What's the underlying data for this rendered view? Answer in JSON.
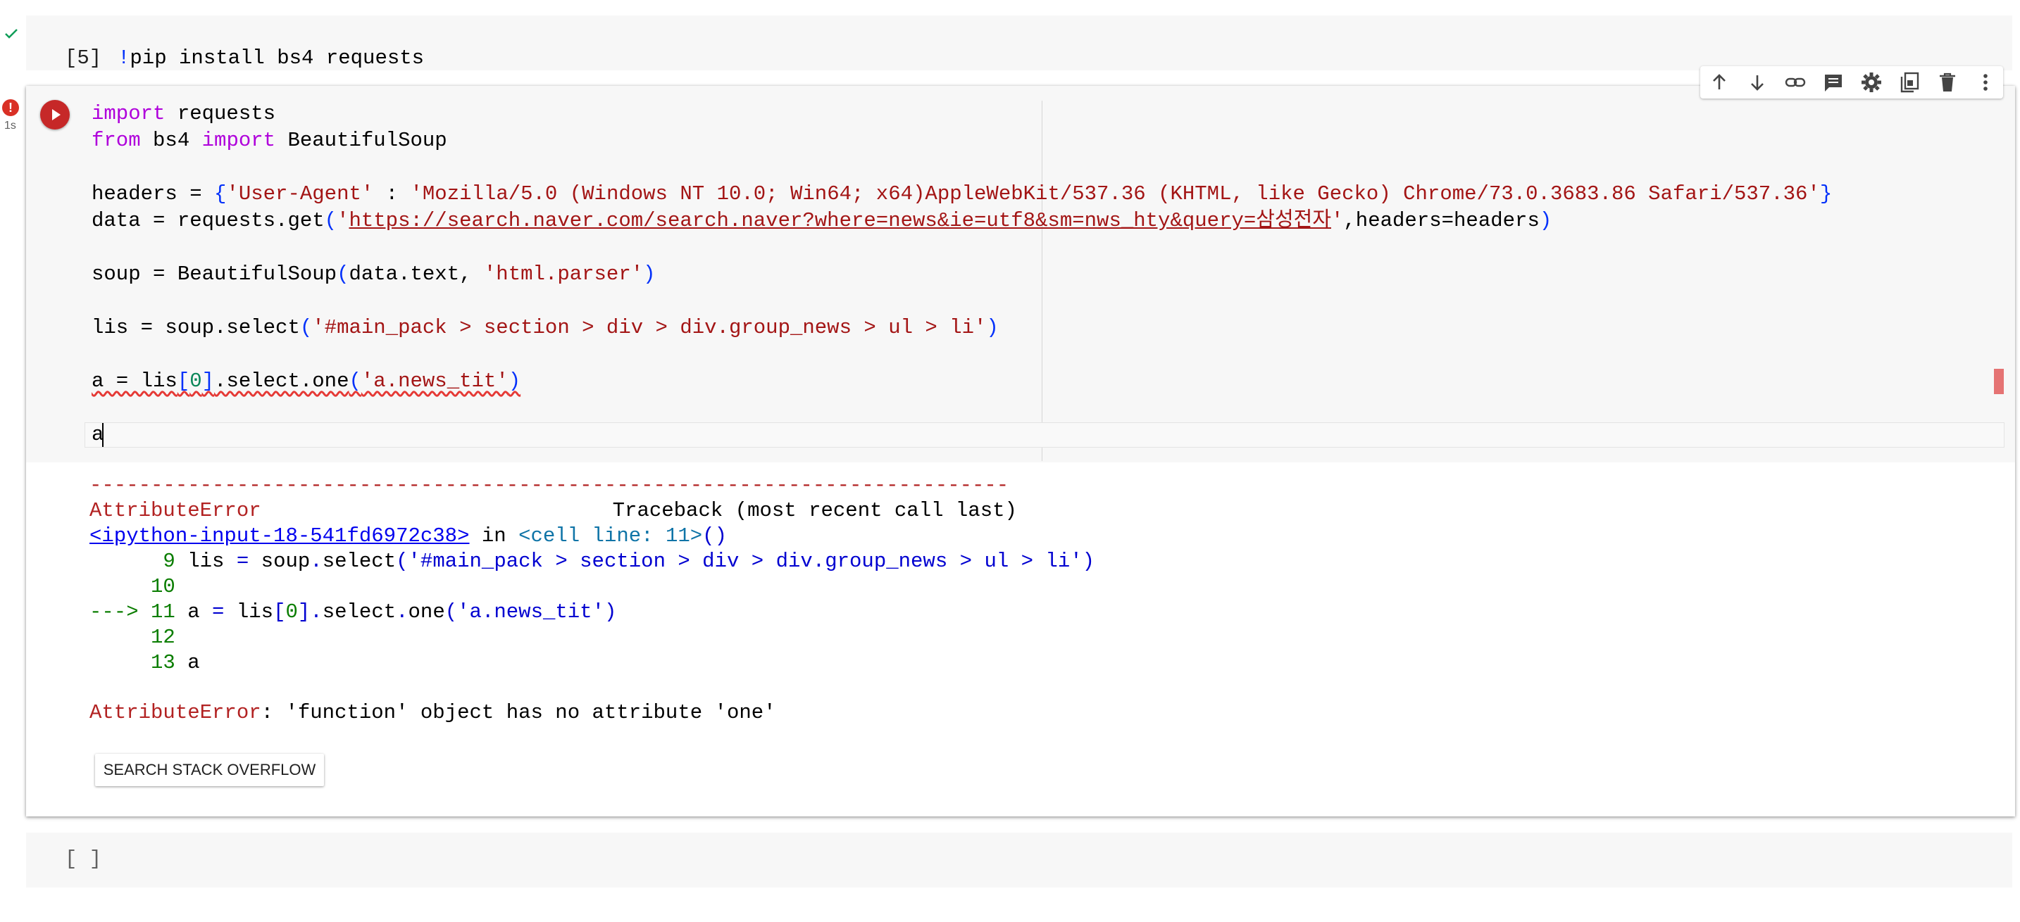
{
  "cell1": {
    "exec_count": "[5]",
    "bang": "!",
    "command": "pip install bs4 requests"
  },
  "cell2": {
    "error_badge": "!",
    "exec_time": "1s",
    "code": {
      "l1_kw": "import",
      "l1_rest": " requests",
      "l2_kw1": "from",
      "l2_mid": " bs4 ",
      "l2_kw2": "import",
      "l2_rest": " BeautifulSoup",
      "l4_a": "headers = ",
      "l4_open": "{",
      "l4_key": "'User-Agent'",
      "l4_colon": " : ",
      "l4_val": "'Mozilla/5.0 (Windows NT 10.0; Win64; x64)AppleWebKit/537.36 (KHTML, like Gecko) Chrome/73.0.3683.86 Safari/537.36'",
      "l4_close": "}",
      "l5_a": "data = requests.get",
      "l5_open": "(",
      "l5_q1": "'",
      "l5_url": "https://search.naver.com/search.naver?where=news&ie=utf8&sm=nws_hty&query=삼성전자",
      "l5_q2": "'",
      "l5_rest": ",headers=headers",
      "l5_close": ")",
      "l7_a": "soup = BeautifulSoup",
      "l7_open": "(",
      "l7_mid": "data.text, ",
      "l7_str": "'html.parser'",
      "l7_close": ")",
      "l9_a": "lis = soup.select",
      "l9_open": "(",
      "l9_str": "'#main_pack > section > div > div.group_news > ul > li'",
      "l9_close": ")",
      "l11_a": "a = lis",
      "l11_ob": "[",
      "l11_num": "0",
      "l11_cb": "]",
      "l11_b": ".select.one",
      "l11_open": "(",
      "l11_str": "'a.news_tit'",
      "l11_close": ")",
      "l13": "a"
    }
  },
  "toolbar": {
    "items": [
      "move-up",
      "move-down",
      "link",
      "comment",
      "settings",
      "mirror",
      "delete",
      "more"
    ]
  },
  "output": {
    "dashes": "---------------------------------------------------------------------------",
    "err_name": "AttributeError",
    "traceback_label": "Traceback (most recent call last)",
    "input_link": "<ipython-input-18-541fd6972c38>",
    "in_word": " in ",
    "cell_line": "<cell line: 11>",
    "cell_line_parens": "()",
    "tb9_num": "      9 ",
    "tb9_a": "lis ",
    "tb9_eq": "=",
    "tb9_b": " soup",
    "tb9_dot": ".",
    "tb9_c": "select",
    "tb9_open": "(",
    "tb9_str": "'#main_pack > section > div > div.group_news > ul > li'",
    "tb9_close": ")",
    "tb10_num": "     10",
    "tb11_arrow": "---> 11 ",
    "tb11_a": "a ",
    "tb11_eq": "=",
    "tb11_b": " lis",
    "tb11_ob": "[",
    "tb11_num": "0",
    "tb11_cb": "]",
    "tb11_dot1": ".",
    "tb11_c": "select",
    "tb11_dot2": ".",
    "tb11_d": "one",
    "tb11_open": "(",
    "tb11_str": "'a.news_tit'",
    "tb11_close": ")",
    "tb12_num": "     12",
    "tb13_num": "     13 ",
    "tb13_a": "a",
    "final_name": "AttributeError",
    "final_msg": ": 'function' object has no attribute 'one'",
    "so_button": "SEARCH STACK OVERFLOW"
  },
  "cell3": {
    "exec_count": "[ ]"
  },
  "colors": {
    "keyword": "#af00db",
    "string": "#a31515",
    "bracket": "#0431fa",
    "error": "#b22222",
    "run_button": "#c62828"
  }
}
